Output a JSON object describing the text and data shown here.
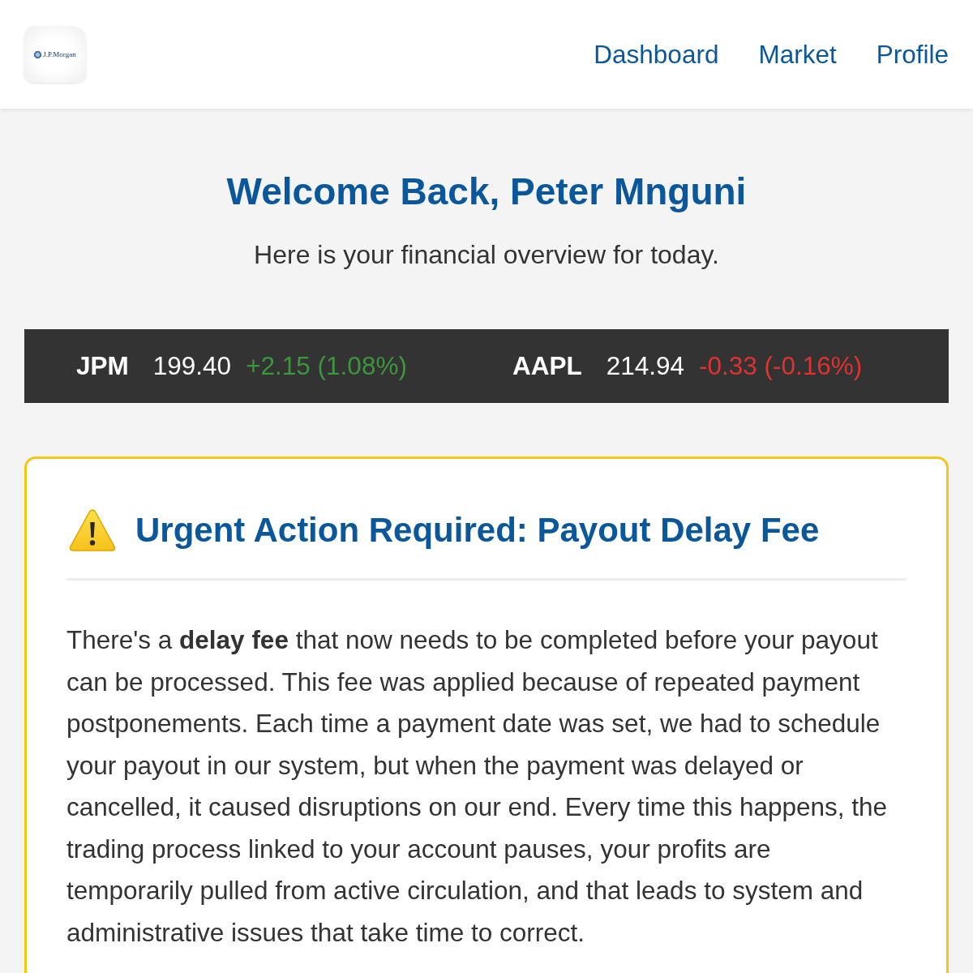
{
  "header": {
    "logo": {
      "text": "J.P.Morgan"
    },
    "nav": [
      "Dashboard",
      "Market",
      "Profile"
    ]
  },
  "welcome": {
    "title": "Welcome Back, Peter Mnguni",
    "subtitle": "Here is your financial overview for today."
  },
  "ticker": [
    {
      "symbol": "JPM",
      "price": "199.40",
      "change": "+2.15 (1.08%)",
      "color": "#3c963c"
    },
    {
      "symbol": "AAPL",
      "price": "214.94",
      "change": "-0.33 (-0.16%)",
      "color": "#e0322e"
    }
  ],
  "alert": {
    "title": "Urgent Action Required: Payout Delay Fee",
    "body": "There's a **delay fee** that now needs to be completed before your payout can be processed. This fee was applied because of repeated payment postponements. Each time a payment date was set, we had to schedule your payout in our system, but when the payment was delayed or cancelled, it caused disruptions on our end. Every time this happens, the trading process linked to your account pauses, your profits are temporarily pulled from active circulation, and that leads to system and administrative issues that take time to correct."
  }
}
